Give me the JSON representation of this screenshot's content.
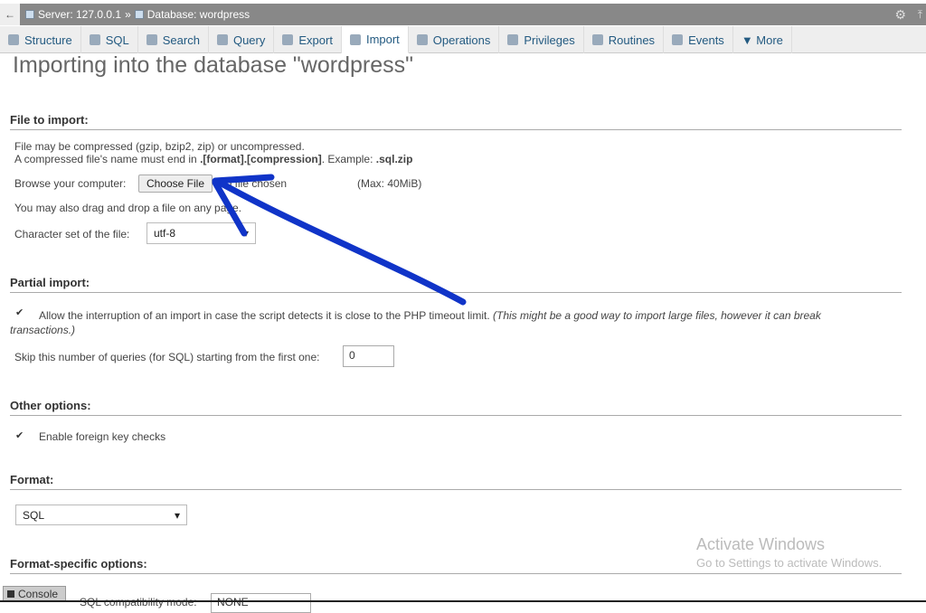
{
  "breadcrumb": {
    "server": "Server: 127.0.0.1",
    "sep": "»",
    "database": "Database: wordpress"
  },
  "tabs": [
    {
      "label": "Structure",
      "icon": "structure-icon"
    },
    {
      "label": "SQL",
      "icon": "sql-icon"
    },
    {
      "label": "Search",
      "icon": "search-icon"
    },
    {
      "label": "Query",
      "icon": "query-icon"
    },
    {
      "label": "Export",
      "icon": "export-icon"
    },
    {
      "label": "Import",
      "icon": "import-icon"
    },
    {
      "label": "Operations",
      "icon": "wrench-icon"
    },
    {
      "label": "Privileges",
      "icon": "privileges-icon"
    },
    {
      "label": "Routines",
      "icon": "routines-icon"
    },
    {
      "label": "Events",
      "icon": "clock-icon"
    },
    {
      "label": "▼ More",
      "icon": "more-icon"
    }
  ],
  "title": "Importing into the database \"wordpress\"",
  "file_import": {
    "heading": "File to import:",
    "line1": "File may be compressed (gzip, bzip2, zip) or uncompressed.",
    "line2_pre": "A compressed file's name must end in ",
    "line2_bold": ".[format].[compression]",
    "line2_mid": ". Example: ",
    "line2_ex": ".sql.zip",
    "browse_label": "Browse your computer:",
    "choose_file": "Choose File",
    "no_file": "No file chosen",
    "max": "(Max: 40MiB)",
    "drag": "You may also drag and drop a file on any page.",
    "charset_label": "Character set of the file:",
    "charset": "utf-8"
  },
  "partial": {
    "heading": "Partial import:",
    "allow": "Allow the interruption of an import in case the script detects it is close to the PHP timeout limit.",
    "allow_note": "(This might be a good way to import large files, however it can break",
    "allow_note2": "transactions.)",
    "skip_label": "Skip this number of queries (for SQL) starting from the first one:",
    "skip_value": "0"
  },
  "other": {
    "heading": "Other options:",
    "fk": "Enable foreign key checks"
  },
  "format": {
    "heading": "Format:",
    "value": "SQL"
  },
  "format_specific": {
    "heading": "Format-specific options:",
    "compat_label": "SQL compatibility mode:",
    "compat_value": "NONE"
  },
  "watermark": {
    "title": "Activate Windows",
    "sub": "Go to Settings to activate Windows."
  },
  "console": "Console",
  "colors": {
    "link": "#235a81",
    "annotation": "#1034c8"
  }
}
